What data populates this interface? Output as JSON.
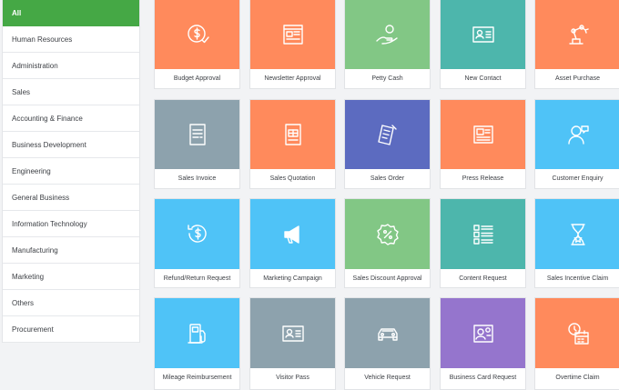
{
  "sidebar": {
    "categories": [
      {
        "label": "All",
        "name": "category-all",
        "active": true
      },
      {
        "label": "Human Resources",
        "name": "category-human-resources"
      },
      {
        "label": "Administration",
        "name": "category-administration"
      },
      {
        "label": "Sales",
        "name": "category-sales"
      },
      {
        "label": "Accounting & Finance",
        "name": "category-accounting-finance"
      },
      {
        "label": "Business Development",
        "name": "category-business-development"
      },
      {
        "label": "Engineering",
        "name": "category-engineering"
      },
      {
        "label": "General Business",
        "name": "category-general-business"
      },
      {
        "label": "Information Technology",
        "name": "category-information-technology"
      },
      {
        "label": "Manufacturing",
        "name": "category-manufacturing"
      },
      {
        "label": "Marketing",
        "name": "category-marketing"
      },
      {
        "label": "Others",
        "name": "category-others"
      },
      {
        "label": "Procurement",
        "name": "category-procurement"
      }
    ]
  },
  "colors": {
    "active_category": "#45a845",
    "orange": "#ff8a5c",
    "green": "#82c785",
    "teal": "#4db6ac",
    "blue_grey": "#8da2ad",
    "indigo": "#5c6bc0",
    "sky": "#4fc3f7",
    "purple": "#9575cd"
  },
  "templates": [
    {
      "label": "Budget Approval",
      "name": "template-budget-approval",
      "color": "#ff8a5c",
      "icon": "dollar-coin-icon"
    },
    {
      "label": "Newsletter Approval",
      "name": "template-newsletter-approval",
      "color": "#ff8a5c",
      "icon": "newsletter-icon"
    },
    {
      "label": "Petty Cash",
      "name": "template-petty-cash",
      "color": "#82c785",
      "icon": "hand-coin-icon"
    },
    {
      "label": "New Contact",
      "name": "template-new-contact",
      "color": "#4db6ac",
      "icon": "contact-card-icon"
    },
    {
      "label": "Asset Purchase",
      "name": "template-asset-purchase",
      "color": "#ff8a5c",
      "icon": "robot-arm-icon"
    },
    {
      "label": "Sales Invoice",
      "name": "template-sales-invoice",
      "color": "#8da2ad",
      "icon": "invoice-icon"
    },
    {
      "label": "Sales Quotation",
      "name": "template-sales-quotation",
      "color": "#ff8a5c",
      "icon": "quotation-icon"
    },
    {
      "label": "Sales Order",
      "name": "template-sales-order",
      "color": "#5c6bc0",
      "icon": "order-receipt-icon"
    },
    {
      "label": "Press Release",
      "name": "template-press-release",
      "color": "#ff8a5c",
      "icon": "newspaper-icon"
    },
    {
      "label": "Customer Enquiry",
      "name": "template-customer-enquiry",
      "color": "#4fc3f7",
      "icon": "customer-chat-icon"
    },
    {
      "label": "Refund/Return Request",
      "name": "template-refund-return-request",
      "color": "#4fc3f7",
      "icon": "refund-dollar-icon"
    },
    {
      "label": "Marketing Campaign",
      "name": "template-marketing-campaign",
      "color": "#4fc3f7",
      "icon": "megaphone-icon"
    },
    {
      "label": "Sales Discount Approval",
      "name": "template-sales-discount-approval",
      "color": "#82c785",
      "icon": "percent-badge-icon"
    },
    {
      "label": "Content Request",
      "name": "template-content-request",
      "color": "#4db6ac",
      "icon": "content-list-icon"
    },
    {
      "label": "Sales Incentive Claim",
      "name": "template-sales-incentive-claim",
      "color": "#4fc3f7",
      "icon": "trophy-star-icon"
    },
    {
      "label": "Mileage Reimbursement",
      "name": "template-mileage-reimbursement",
      "color": "#4fc3f7",
      "icon": "fuel-pump-icon"
    },
    {
      "label": "Visitor Pass",
      "name": "template-visitor-pass",
      "color": "#8da2ad",
      "icon": "id-pass-icon"
    },
    {
      "label": "Vehicle Request",
      "name": "template-vehicle-request",
      "color": "#8da2ad",
      "icon": "car-icon"
    },
    {
      "label": "Business Card Request",
      "name": "template-business-card-request",
      "color": "#9575cd",
      "icon": "business-card-icon"
    },
    {
      "label": "Overtime Claim",
      "name": "template-overtime-claim",
      "color": "#ff8a5c",
      "icon": "clock-calendar-icon"
    }
  ]
}
